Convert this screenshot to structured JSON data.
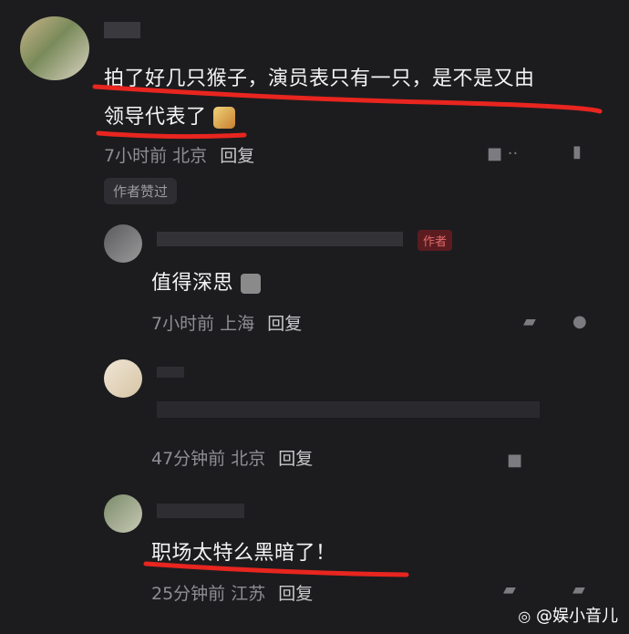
{
  "comments": [
    {
      "text_line1": "拍了好几只猴子，演员表只有一只，是不是又由",
      "text_line2": "领导代表了",
      "time": "7小时前",
      "location": "北京",
      "reply_label": "回复",
      "badge": "作者赞过"
    },
    {
      "author_tag": "作者",
      "text": "值得深思",
      "time": "7小时前",
      "location": "上海",
      "reply_label": "回复"
    },
    {
      "time": "47分钟前",
      "location": "北京",
      "reply_label": "回复"
    },
    {
      "text": "职场太特么黑暗了！",
      "time": "25分钟前",
      "location": "江苏",
      "reply_label": "回复"
    }
  ],
  "watermark": "@娱小音儿",
  "colors": {
    "background": "#1c1c1f",
    "underline": "#e8251f",
    "meta": "#8e8e93"
  }
}
